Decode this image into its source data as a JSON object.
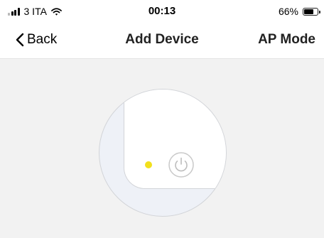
{
  "status_bar": {
    "carrier": "3 ITA",
    "time": "00:13",
    "battery_percent": "66%",
    "battery_level": 0.66
  },
  "nav": {
    "back_label": "Back",
    "title": "Add Device",
    "right_action_label": "AP Mode"
  },
  "illustration": {
    "indicator_light_color": "#f2e01c",
    "icons": [
      "power-icon"
    ]
  }
}
